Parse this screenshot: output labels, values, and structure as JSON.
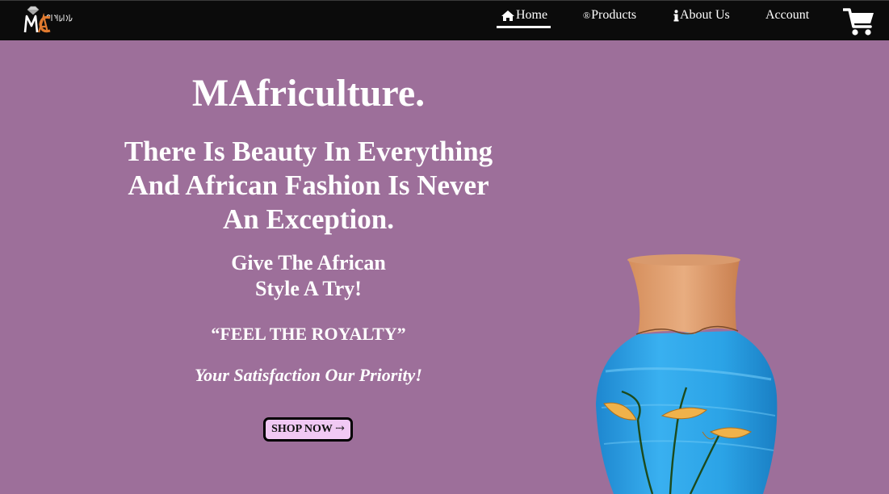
{
  "nav": {
    "logo_alt": "MAfriculture logo",
    "items": [
      {
        "label": "Home",
        "icon": "home-icon",
        "active": true
      },
      {
        "label": "Products",
        "icon": "registered-icon",
        "active": false
      },
      {
        "label": "About Us",
        "icon": "info-icon",
        "active": false
      },
      {
        "label": "Account",
        "icon": "",
        "active": false
      }
    ],
    "cart_icon": "shopping-cart-icon"
  },
  "hero": {
    "brand": "MAfriculture.",
    "tagline_lines": [
      "There Is Beauty In Everything",
      "And African Fashion Is Never",
      "An Exception."
    ],
    "try_lines": [
      "Give The African",
      "Style A Try!"
    ],
    "royalty": "“FEEL THE ROYALTY”",
    "priority": "Your Satisfaction Our Priority!",
    "cta_label": "SHOP NOW ⤑"
  },
  "colors": {
    "background": "#9d6f9a",
    "navbar": "#0b0b0b",
    "text": "#ffffff",
    "button_bg": "#f1c9f4",
    "vase_blue": "#2aa3e6",
    "vase_neck": "#e0a476"
  }
}
